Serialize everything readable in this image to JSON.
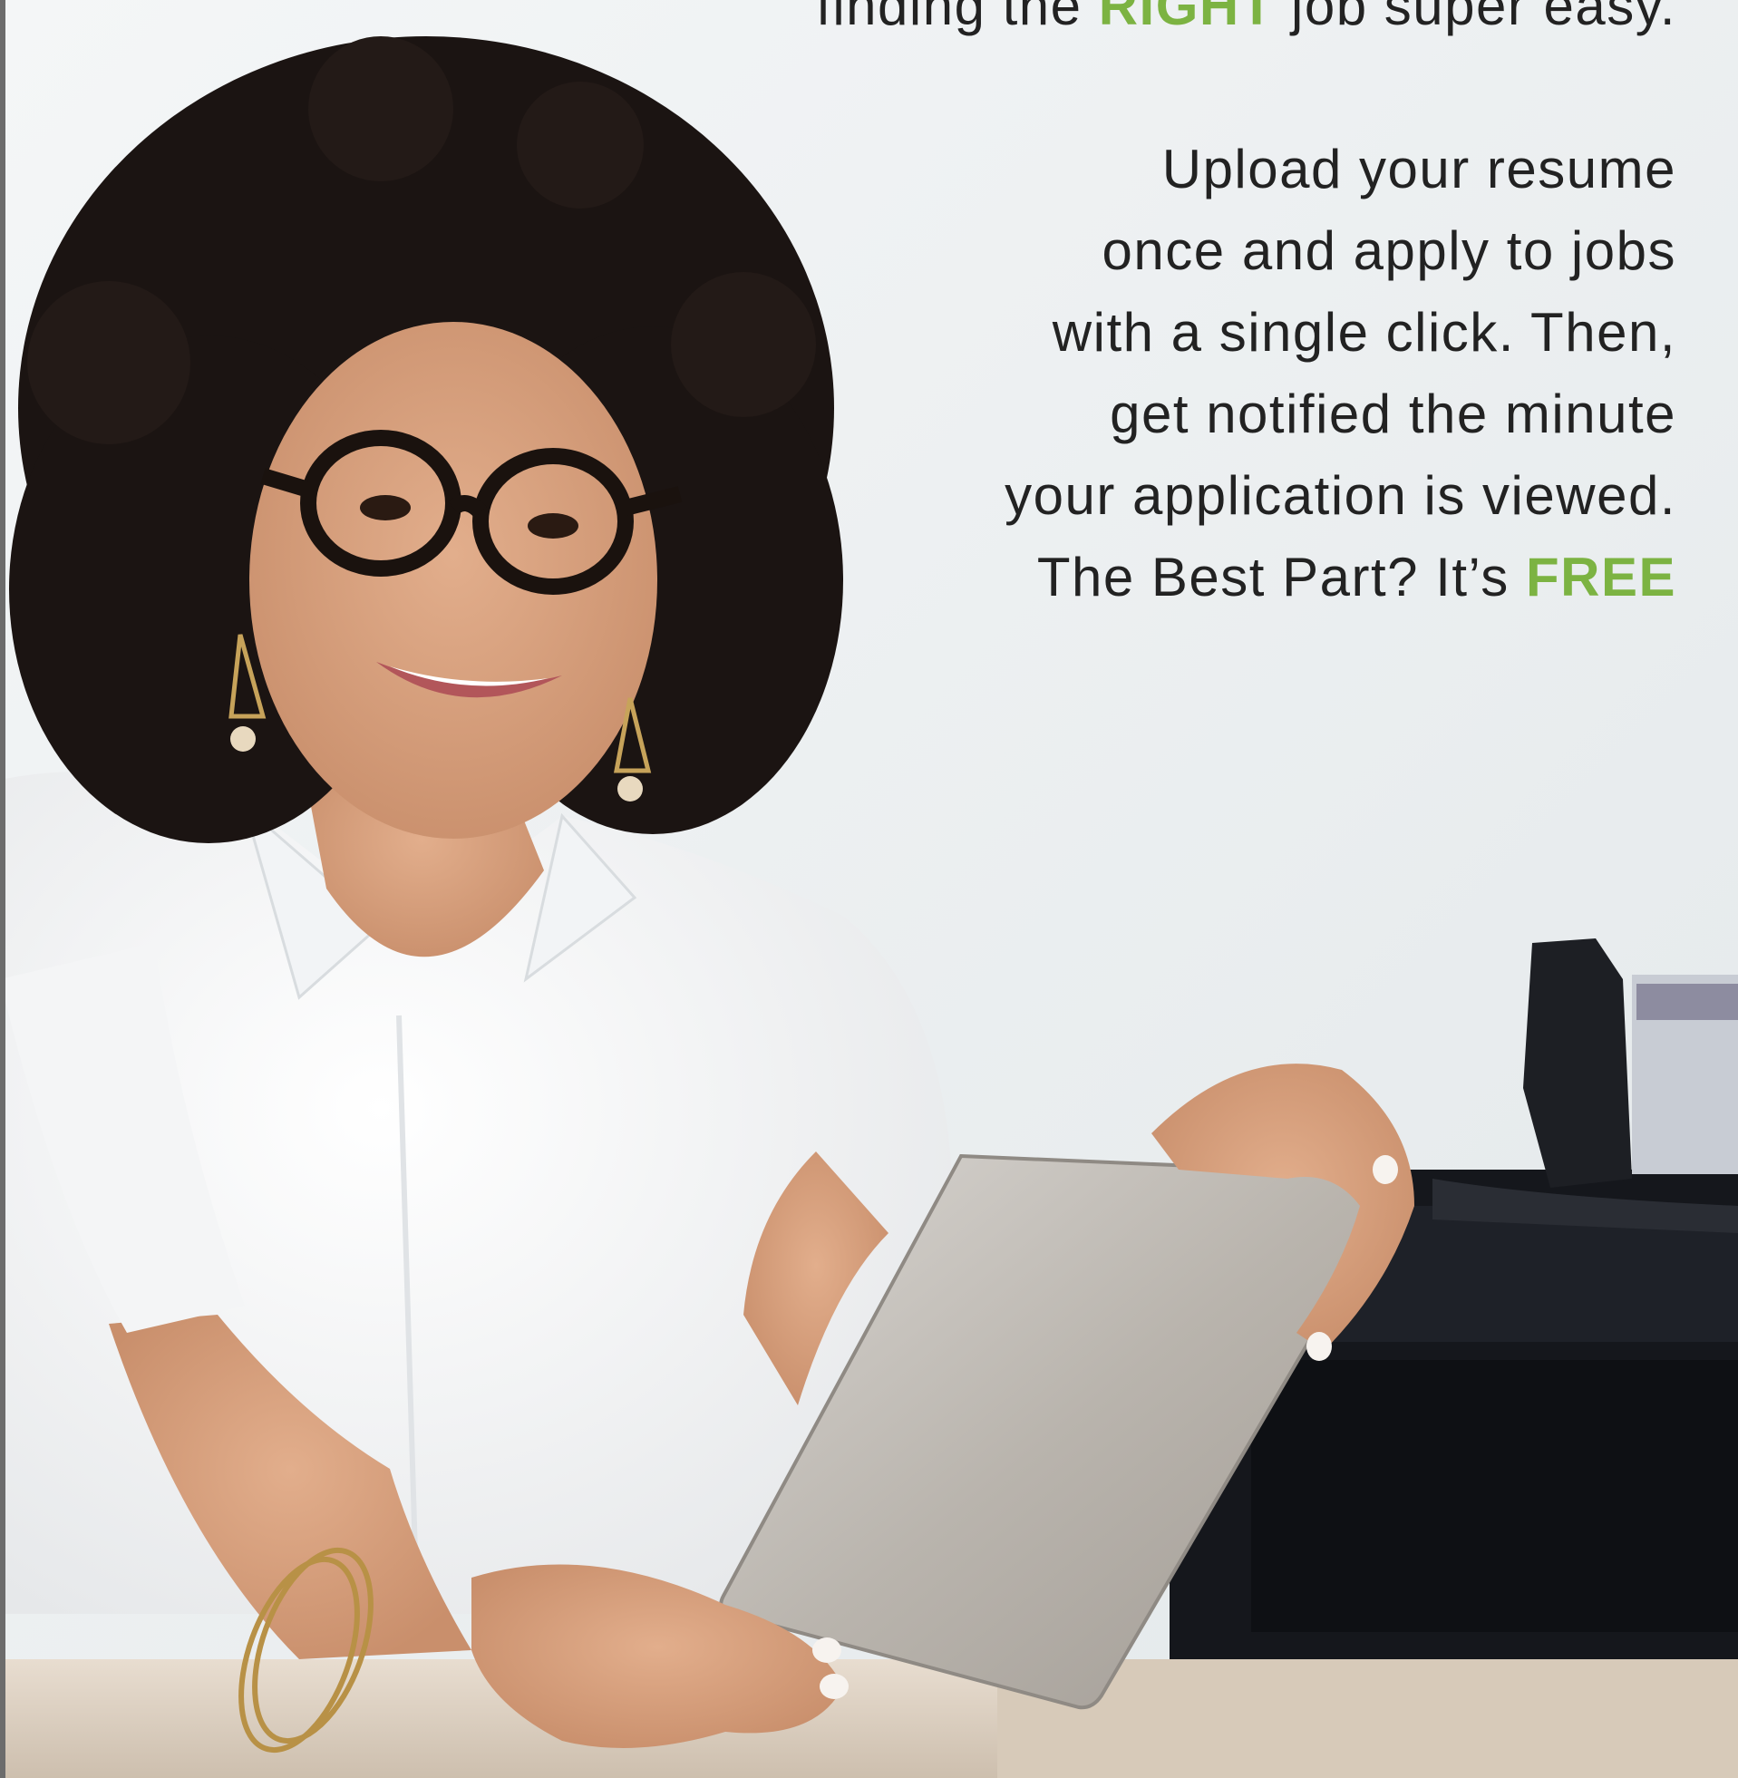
{
  "headline": {
    "before": "finding the ",
    "highlight": "RIGHT",
    "after": " job super easy."
  },
  "body_lines": [
    "Upload your resume",
    "once and apply to jobs",
    "with a single click. Then,",
    "get notified the minute",
    "your application is viewed."
  ],
  "closing": {
    "before": "The Best Part? It’s ",
    "highlight": "FREE"
  },
  "colors": {
    "accent_green": "#7cb342",
    "text": "#222222",
    "background_wall": "#eaeef0"
  }
}
